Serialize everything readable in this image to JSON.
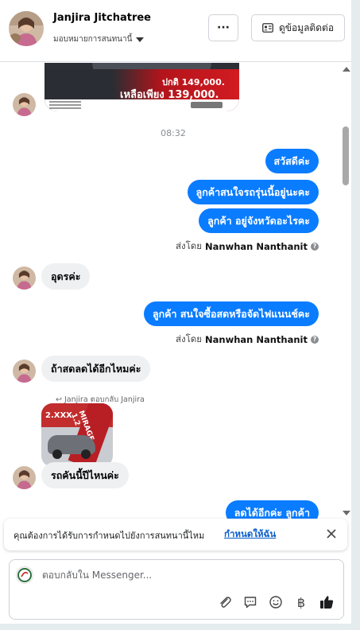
{
  "header": {
    "contact_name": "Janjira Jitchatree",
    "assign_label": "มอบหมายการสนทนานี้",
    "more_label": "···",
    "view_contact_label": "ดูข้อมูลติดต่อ"
  },
  "conversation": {
    "top_image": {
      "price_old": "ปกติ 149,000.",
      "price_new": "เหลือเพียง 139,000."
    },
    "timestamp": "08:32",
    "messages_block1": [
      "สวัสดีค่ะ",
      "ลูกค้าสนใจรถรุ่นนี้อยู่นะคะ",
      "ลูกค้า อยู่จังหวัดอะไรคะ"
    ],
    "sent_by_prefix": "ส่งโดย",
    "sent_by_name": "Nanwhan Nanthanit",
    "incoming1": "อุดรค่ะ",
    "outgoing2": "ลูกค้า สนใจซื้อสดหรือจัดไฟแนนช์คะ",
    "incoming2": "ถ้าสดลดได้อีกไหมค่ะ",
    "reply_label": "Janjira ตอบกลับ Janjira",
    "reply_image": {
      "badge": "2.XXX",
      "model": "MIRAGE 1.2"
    },
    "incoming3": "รถคันนี้ปีไหนค่ะ",
    "outgoing3": "ลดได้อีกค่ะ ลูกค้า"
  },
  "notice": {
    "text": "คุณต้องการได้รับการกำหนดไปยังการสนทนานี้ไหม",
    "link": "กำหนดให้ฉัน"
  },
  "composer": {
    "placeholder": "ตอบกลับใน Messenger...",
    "baht_symbol": "฿"
  },
  "colors": {
    "outgoing_bubble": "#0a7cff",
    "incoming_bubble": "#eef0f2",
    "link": "#0a5ec9",
    "like": "#1c1e21"
  }
}
